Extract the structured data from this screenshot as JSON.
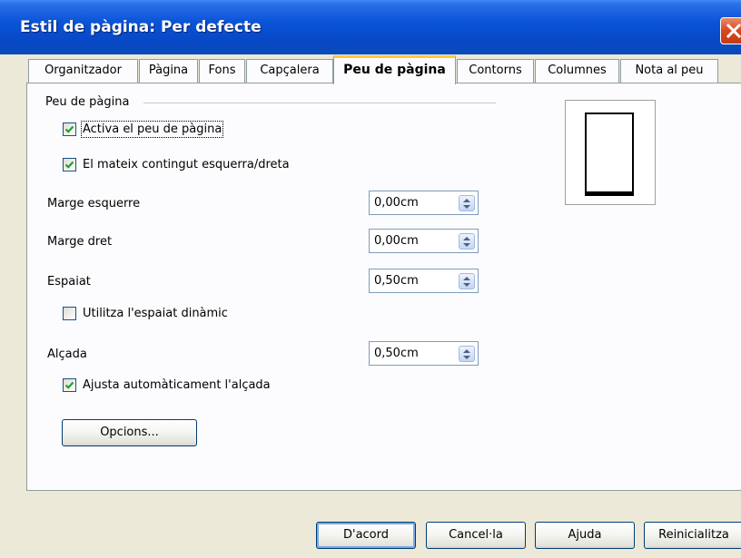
{
  "window": {
    "title": "Estil de pàgina: Per defecte"
  },
  "tabs": [
    {
      "label": "Organitzador"
    },
    {
      "label": "Pàgina"
    },
    {
      "label": "Fons"
    },
    {
      "label": "Capçalera"
    },
    {
      "label": "Peu de pàgina",
      "active": true
    },
    {
      "label": "Contorns"
    },
    {
      "label": "Columnes"
    },
    {
      "label": "Nota al peu"
    }
  ],
  "footer_section": {
    "group_label": "Peu de pàgina",
    "activate": {
      "label": "Activa el peu de pàgina",
      "checked": true
    },
    "same_content": {
      "label": "El mateix contingut esquerra/dreta",
      "checked": true
    },
    "left_margin": {
      "label": "Marge esquerre",
      "value": "0,00cm"
    },
    "right_margin": {
      "label": "Marge dret",
      "value": "0,00cm"
    },
    "spacing": {
      "label": "Espaiat",
      "value": "0,50cm"
    },
    "dynamic_spacing": {
      "label": "Utilitza l'espaiat dinàmic",
      "checked": false
    },
    "height": {
      "label": "Alçada",
      "value": "0,50cm"
    },
    "autofit_height": {
      "label": "Ajusta automàticament l'alçada",
      "checked": true
    },
    "options_button": "Opcions..."
  },
  "buttons": {
    "ok": "D'acord",
    "cancel": "Cancel·la",
    "help": "Ajuda",
    "reset": "Reinicialitza"
  }
}
